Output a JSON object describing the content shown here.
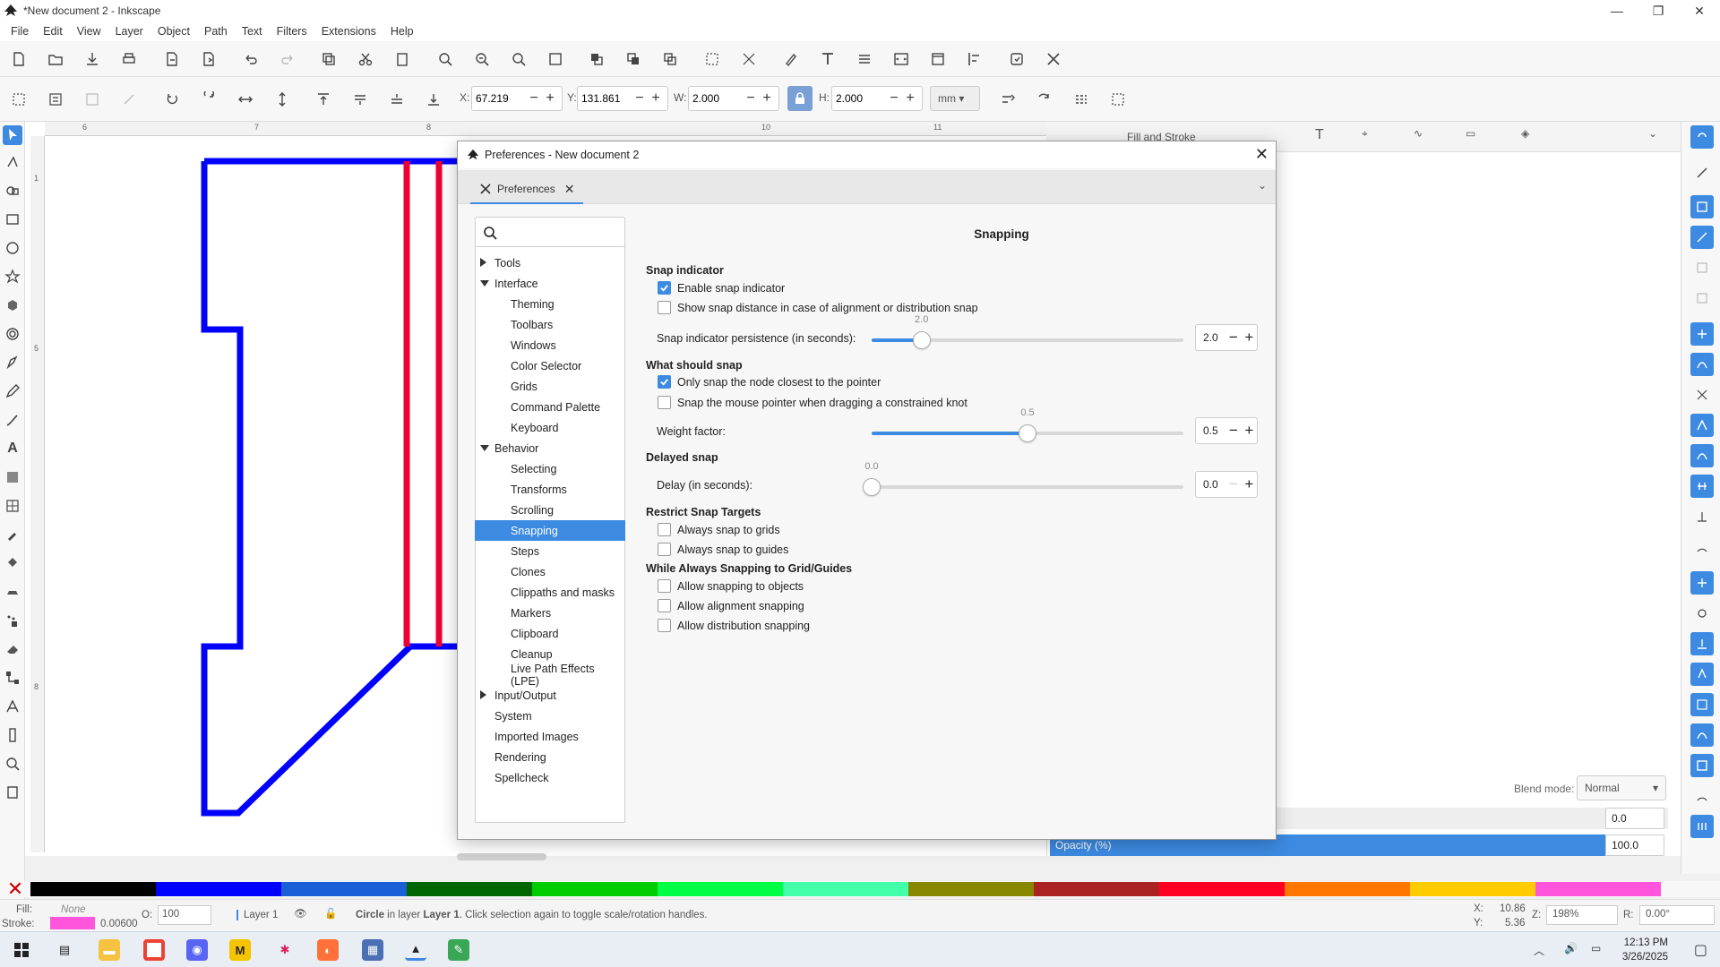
{
  "window": {
    "title": "*New document 2 - Inkscape",
    "minimize": "—",
    "restore": "❐",
    "close": "✕"
  },
  "menu": [
    "File",
    "Edit",
    "View",
    "Layer",
    "Object",
    "Path",
    "Text",
    "Filters",
    "Extensions",
    "Help"
  ],
  "toolbar": {
    "x_label": "X:",
    "x_value": "67.219",
    "y_label": "Y:",
    "y_value": "131.861",
    "w_label": "W:",
    "w_value": "2.000",
    "h_label": "H:",
    "h_value": "2.000",
    "unit": "mm"
  },
  "ruler": {
    "top": [
      "6",
      "7",
      "8",
      "10",
      "11"
    ],
    "left": [
      "1",
      "5",
      "8"
    ]
  },
  "dock": {
    "tab_fill_stroke": "Fill and Stroke",
    "blend_label": "Blend mode:",
    "blend_value": "Normal",
    "blur_value": "0.0",
    "opacity_label": "Opacity (%)",
    "opacity_value": "100.0"
  },
  "dialog": {
    "title": "Preferences - New document 2",
    "tab_label": "Preferences",
    "search_placeholder": "",
    "section_title": "Snapping",
    "nav": [
      {
        "label": "Tools",
        "level": 0,
        "expander": "collapsed"
      },
      {
        "label": "Interface",
        "level": 0,
        "expander": "expanded"
      },
      {
        "label": "Theming",
        "level": 1
      },
      {
        "label": "Toolbars",
        "level": 1
      },
      {
        "label": "Windows",
        "level": 1
      },
      {
        "label": "Color Selector",
        "level": 1
      },
      {
        "label": "Grids",
        "level": 1
      },
      {
        "label": "Command Palette",
        "level": 1
      },
      {
        "label": "Keyboard",
        "level": 1
      },
      {
        "label": "Behavior",
        "level": 0,
        "expander": "expanded"
      },
      {
        "label": "Selecting",
        "level": 1
      },
      {
        "label": "Transforms",
        "level": 1
      },
      {
        "label": "Scrolling",
        "level": 1
      },
      {
        "label": "Snapping",
        "level": 1,
        "selected": true
      },
      {
        "label": "Steps",
        "level": 1
      },
      {
        "label": "Clones",
        "level": 1
      },
      {
        "label": "Clippaths and masks",
        "level": 1
      },
      {
        "label": "Markers",
        "level": 1
      },
      {
        "label": "Clipboard",
        "level": 1
      },
      {
        "label": "Cleanup",
        "level": 1
      },
      {
        "label": "Live Path Effects (LPE)",
        "level": 1
      },
      {
        "label": "Input/Output",
        "level": 0,
        "expander": "collapsed"
      },
      {
        "label": "System",
        "level": 0
      },
      {
        "label": "Imported Images",
        "level": 0
      },
      {
        "label": "Rendering",
        "level": 0
      },
      {
        "label": "Spellcheck",
        "level": 0
      }
    ],
    "snap_indicator": {
      "heading": "Snap indicator",
      "enable_label": "Enable snap indicator",
      "enable_checked": true,
      "distance_label": "Show snap distance in case of alignment or distribution snap",
      "distance_checked": false,
      "persistence_label": "Snap indicator persistence (in seconds):",
      "persistence_value": "2.0",
      "persistence_fraction": 0.16
    },
    "what_should_snap": {
      "heading": "What should snap",
      "closest_label": "Only snap the node closest to the pointer",
      "closest_checked": true,
      "mouse_label": "Snap the mouse pointer when dragging a constrained knot",
      "mouse_checked": false,
      "weight_label": "Weight factor:",
      "weight_value": "0.5",
      "weight_fraction": 0.5
    },
    "delayed_snap": {
      "heading": "Delayed snap",
      "delay_label": "Delay (in seconds):",
      "delay_value": "0.0",
      "delay_fraction": 0
    },
    "restrict": {
      "heading": "Restrict Snap Targets",
      "grids_label": "Always snap to grids",
      "guides_label": "Always snap to guides"
    },
    "while_always": {
      "heading": "While Always Snapping to Grid/Guides",
      "objects_label": "Allow snapping to objects",
      "alignment_label": "Allow alignment snapping",
      "distribution_label": "Allow distribution snapping"
    }
  },
  "palette": [
    "#000000",
    "#0000ff",
    "#1a5fd6",
    "#006600",
    "#00cc00",
    "#00ff44",
    "#44ffaa",
    "#888800",
    "#aa2222",
    "#ff0022",
    "#ff7700",
    "#ffcc00",
    "#ff55dd"
  ],
  "status": {
    "fill_label": "Fill:",
    "fill_value": "None",
    "stroke_label": "Stroke:",
    "stroke_width": "0.00600",
    "o_label": "O:",
    "o_value": "100",
    "layer": "Layer 1",
    "message_obj": "Circle",
    "message_mid": " in layer ",
    "message_layer": "Layer 1",
    "message_end": ". Click selection again to toggle scale/rotation handles.",
    "cx_label": "X:",
    "cx": "10.86",
    "cy_label": "Y:",
    "cy": "5.36",
    "z_label": "Z:",
    "zoom": "198%",
    "r_label": "R:",
    "rotation": "0.00°"
  },
  "taskbar": {
    "time": "12:13 PM",
    "date": "3/26/2025"
  },
  "colors": {
    "accent": "#3c8ae2",
    "shape_blue": "#0000ff",
    "shape_red": "#ee0033"
  }
}
